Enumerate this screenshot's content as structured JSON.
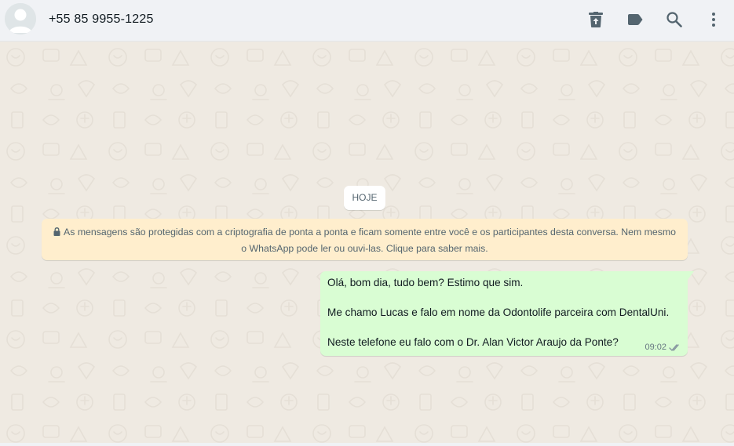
{
  "header": {
    "contact_name": "+55 85 9955-1225",
    "icons": [
      "archive-icon",
      "label-icon",
      "search-icon",
      "menu-icon"
    ]
  },
  "chat": {
    "date_label": "HOJE",
    "encryption_notice": {
      "line1": "As mensagens são protegidas com a criptografia de ponta a ponta e ficam somente entre você e os participantes desta conversa. Nem mesmo",
      "line2": "o WhatsApp pode ler ou ouvi-las. Clique para saber mais."
    },
    "messages": [
      {
        "direction": "outgoing",
        "lines": [
          "Olá, bom dia, tudo bem? Estimo que sim.",
          "Me chamo Lucas e falo em nome da Odontolife parceira com DentalUni.",
          "Neste telefone eu falo com o Dr. Alan Victor Araujo da Ponte?"
        ],
        "time": "09:02",
        "status": "read"
      }
    ]
  },
  "colors": {
    "header_bg": "#f0f2f5",
    "chat_bg": "#efeae2",
    "outgoing_bubble": "#d9fdd3",
    "encryption_bg": "#ffeecd",
    "icon": "#54656f",
    "read_ticks": "#8696a0"
  }
}
